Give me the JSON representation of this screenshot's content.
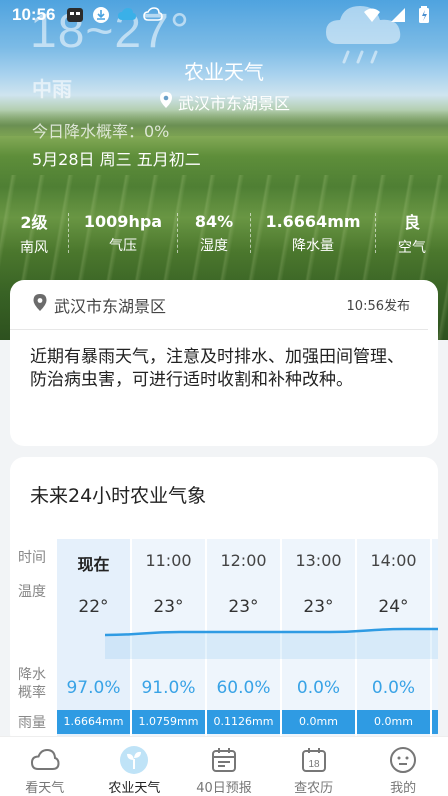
{
  "status_bar": {
    "time": "10:56"
  },
  "hero": {
    "big_temp": "18~27°",
    "weather_desc": "中雨",
    "rain_prob": "今日降水概率：0%",
    "date": "5月28日 周三 五月初二",
    "page_title": "农业天气",
    "location": "武汉市东湖景区"
  },
  "metrics": [
    {
      "value": "2级",
      "label": "南风"
    },
    {
      "value": "1009hpa",
      "label": "气压"
    },
    {
      "value": "84%",
      "label": "湿度"
    },
    {
      "value": "1.6664mm",
      "label": "降水量"
    },
    {
      "value": "良",
      "label": "空气"
    }
  ],
  "advice": {
    "location": "武汉市东湖景区",
    "publish_time": "10:56发布",
    "text": "近期有暴雨天气，注意及时排水、加强田间管理、防治病虫害，可进行适时收割和补种改种。"
  },
  "forecast": {
    "title": "未来24小时农业气象",
    "row_labels": {
      "time": "时间",
      "temp": "温度",
      "prob_line1": "降水",
      "prob_line2": "概率",
      "rain": "雨量"
    },
    "hours": [
      {
        "time": "现在",
        "temp": "22°",
        "temp_value": 22,
        "prob": "97.0%",
        "rain": "1.6664mm"
      },
      {
        "time": "11:00",
        "temp": "23°",
        "temp_value": 23,
        "prob": "91.0%",
        "rain": "1.0759mm"
      },
      {
        "time": "12:00",
        "temp": "23°",
        "temp_value": 23,
        "prob": "60.0%",
        "rain": "0.1126mm"
      },
      {
        "time": "13:00",
        "temp": "23°",
        "temp_value": 23,
        "prob": "0.0%",
        "rain": "0.0mm"
      },
      {
        "time": "14:00",
        "temp": "24°",
        "temp_value": 24,
        "prob": "0.0%",
        "rain": "0.0mm"
      }
    ]
  },
  "bottom_nav": [
    {
      "label": "看天气",
      "icon": "cloud-icon"
    },
    {
      "label": "农业天气",
      "icon": "sprout-icon"
    },
    {
      "label": "40日预报",
      "icon": "calendar-icon"
    },
    {
      "label": "查农历",
      "icon": "lunar-calendar-icon"
    },
    {
      "label": "我的",
      "icon": "profile-icon"
    }
  ],
  "colors": {
    "accent": "#2f9be3",
    "probability_text": "#39a3e6",
    "nav_active_bg": "#bfe3f7"
  }
}
